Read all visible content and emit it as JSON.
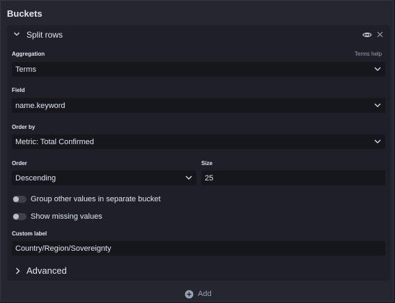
{
  "panel": {
    "title": "Buckets"
  },
  "bucket": {
    "title": "Split rows",
    "aggregation": {
      "label": "Aggregation",
      "help": "Terms help",
      "value": "Terms"
    },
    "field": {
      "label": "Field",
      "value": "name.keyword"
    },
    "order_by": {
      "label": "Order by",
      "value": "Metric: Total Confirmed"
    },
    "order": {
      "label": "Order",
      "value": "Descending"
    },
    "size": {
      "label": "Size",
      "value": "25"
    },
    "toggles": [
      {
        "label": "Group other values in separate bucket",
        "on": false
      },
      {
        "label": "Show missing values",
        "on": false
      }
    ],
    "custom_label": {
      "label": "Custom label",
      "value": "Country/Region/Sovereignty"
    },
    "advanced": {
      "label": "Advanced"
    }
  },
  "add": {
    "label": "Add"
  },
  "icons": {
    "collapse": "chevron-down-icon",
    "visibility": "eye-icon",
    "remove": "close-icon",
    "dropdown": "chevron-down-icon",
    "advanced": "chevron-right-icon",
    "add": "plus-circle-icon"
  },
  "colors": {
    "background": "#1d1e24",
    "panel": "#25262e",
    "card": "#1f2027",
    "input": "#16171c",
    "text": "#dfe5ef",
    "muted": "#98a2b3"
  }
}
